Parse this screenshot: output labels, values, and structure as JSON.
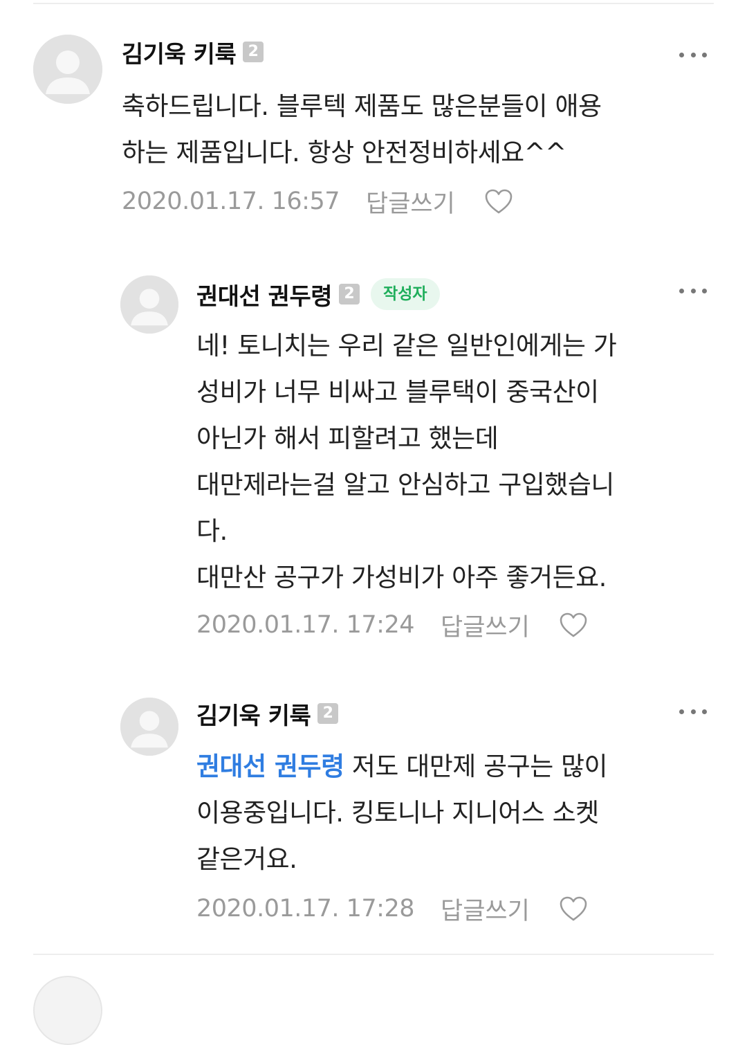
{
  "comments": [
    {
      "author": "김기욱 키룩",
      "level": "2",
      "body": "축하드립니다. 블루텍 제품도 많은분들이 애용\n하는 제품입니다. 항상 안전정비하세요^^",
      "date": "2020.01.17. 16:57",
      "reply_label": "답글쓰기"
    },
    {
      "author": "권대선 권두령",
      "level": "2",
      "writer_badge": "작성자",
      "body": "네! 토니치는 우리 같은 일반인에게는 가\n성비가 너무 비싸고 블루택이 중국산이\n아닌가 해서 피할려고 했는데\n대만제라는걸 알고 안심하고 구입했습니\n다.\n대만산 공구가 가성비가 아주 좋거든요.",
      "date": "2020.01.17. 17:24",
      "reply_label": "답글쓰기"
    },
    {
      "author": "김기욱 키룩",
      "level": "2",
      "mention": "권대선 권두령",
      "body": " 저도 대만제 공구는 많이\n이용중입니다. 킹토니나 지니어스 소켓\n같은거요.",
      "date": "2020.01.17. 17:28",
      "reply_label": "답글쓰기"
    }
  ],
  "icons": {
    "avatar": "default-user-avatar-icon",
    "more": "more-options-icon",
    "like": "heart-outline-icon"
  },
  "colors": {
    "mention": "#2f7de1",
    "writer_badge_text": "#1fae5b",
    "writer_badge_bg": "#e8f7ee",
    "meta_text": "#9a9a9a"
  }
}
